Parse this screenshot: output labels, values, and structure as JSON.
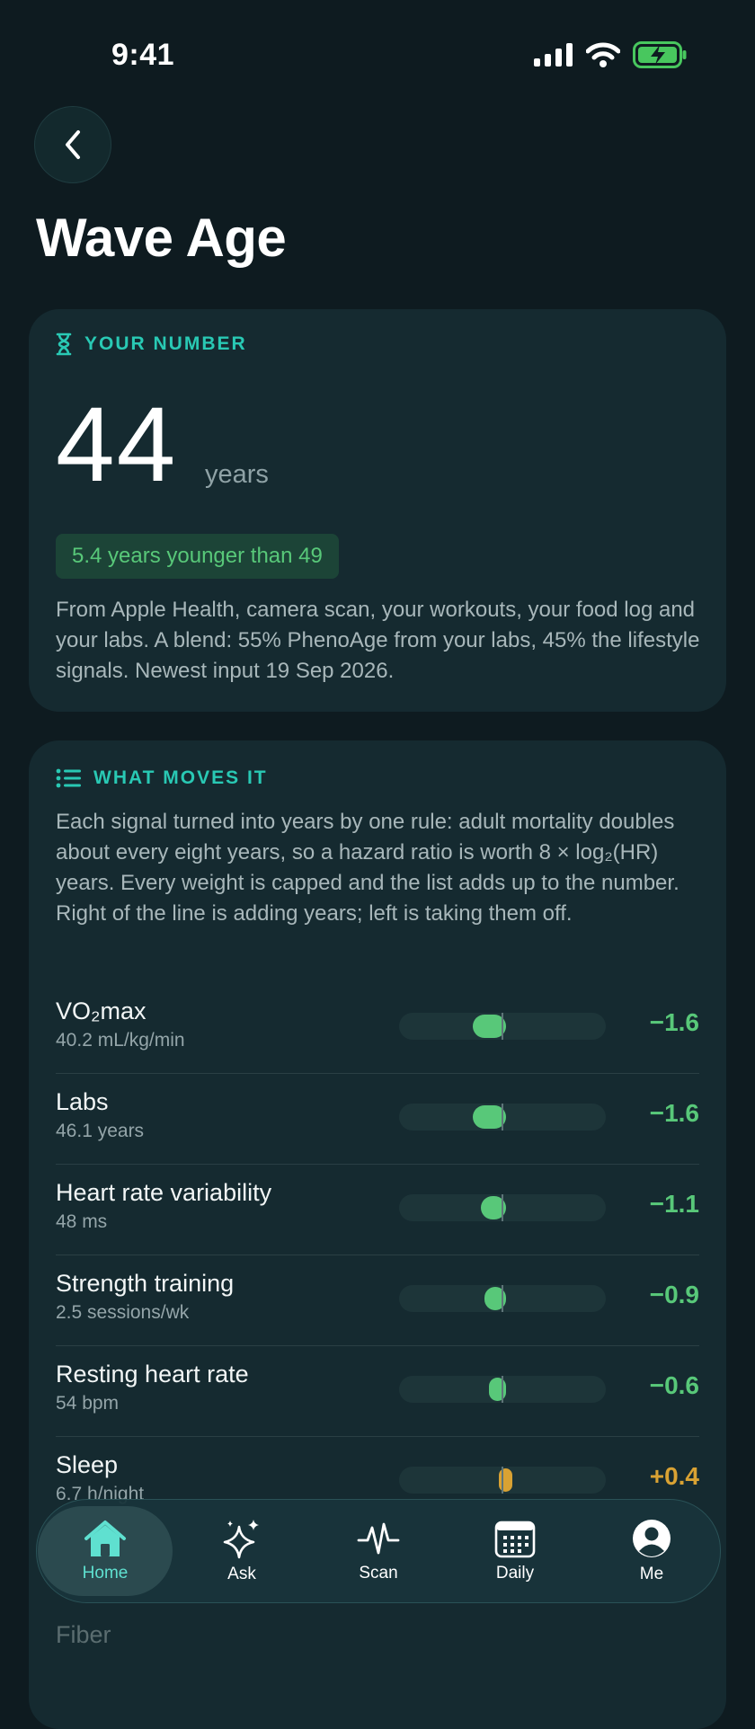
{
  "status": {
    "time": "9:41"
  },
  "page": {
    "title": "Wave Age"
  },
  "number_card": {
    "label": "YOUR NUMBER",
    "value": "44",
    "unit": "years",
    "badge": "5.4 years younger than 49",
    "description": "From Apple Health, camera scan, your workouts, your food log and your labs. A blend: 55% PhenoAge from your labs, 45% the lifestyle signals. Newest input 19 Sep 2026."
  },
  "moves_card": {
    "label": "WHAT MOVES IT",
    "description": "Each signal turned into years by one rule: adult mortality doubles about every eight years, so a hazard ratio is worth 8 × log₂(HR) years. Every weight is capped and the list adds up to the number. Right of the line is adding years; left is taking them off.",
    "rows": [
      {
        "name": "VO₂max",
        "detail": "40.2 mL/kg/min",
        "value": "−1.6",
        "delta": -1.6
      },
      {
        "name": "Labs",
        "detail": "46.1 years",
        "value": "−1.6",
        "delta": -1.6
      },
      {
        "name": "Heart rate variability",
        "detail": "48 ms",
        "value": "−1.1",
        "delta": -1.1
      },
      {
        "name": "Strength training",
        "detail": "2.5 sessions/wk",
        "value": "−0.9",
        "delta": -0.9
      },
      {
        "name": "Resting heart rate",
        "detail": "54 bpm",
        "value": "−0.6",
        "delta": -0.6
      },
      {
        "name": "Sleep",
        "detail": "6.7 h/night",
        "value": "+0.4",
        "delta": 0.4
      }
    ],
    "peek_row": "Fiber"
  },
  "tabs": [
    {
      "label": "Home",
      "icon": "home-icon",
      "active": true
    },
    {
      "label": "Ask",
      "icon": "sparkles-icon",
      "active": false
    },
    {
      "label": "Scan",
      "icon": "pulse-icon",
      "active": false
    },
    {
      "label": "Daily",
      "icon": "calendar-icon",
      "active": false
    },
    {
      "label": "Me",
      "icon": "person-icon",
      "active": false
    }
  ],
  "colors": {
    "accent": "#29c9b4",
    "negative": "#58c879",
    "positive": "#d9a233",
    "background": "#0e1b20",
    "card": "#152a30"
  }
}
